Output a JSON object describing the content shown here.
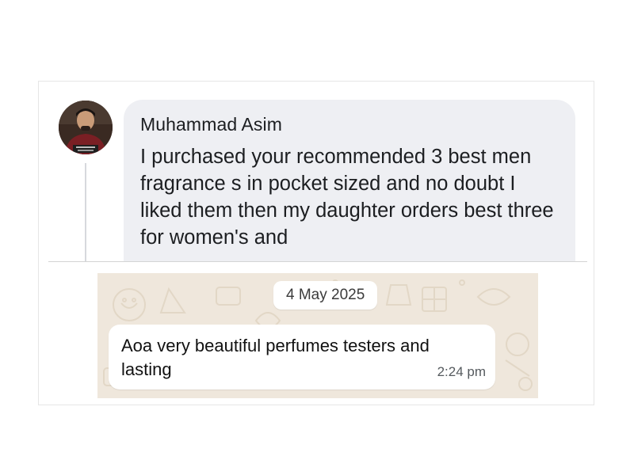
{
  "comment": {
    "author": "Muhammad Asim",
    "text": "I purchased your recommended 3 best men fragrance s in pocket sized and no doubt I liked them then my daughter orders best three for women's and",
    "avatar_icon": "profile-photo"
  },
  "chat": {
    "date": "4 May 2025",
    "message": "Aoa very beautiful perfumes testers and lasting",
    "time": "2:24 pm",
    "wallpaper_color": "#efe7dc"
  },
  "colors": {
    "comment_bubble": "#eeeff3",
    "message_bubble": "#ffffff"
  }
}
